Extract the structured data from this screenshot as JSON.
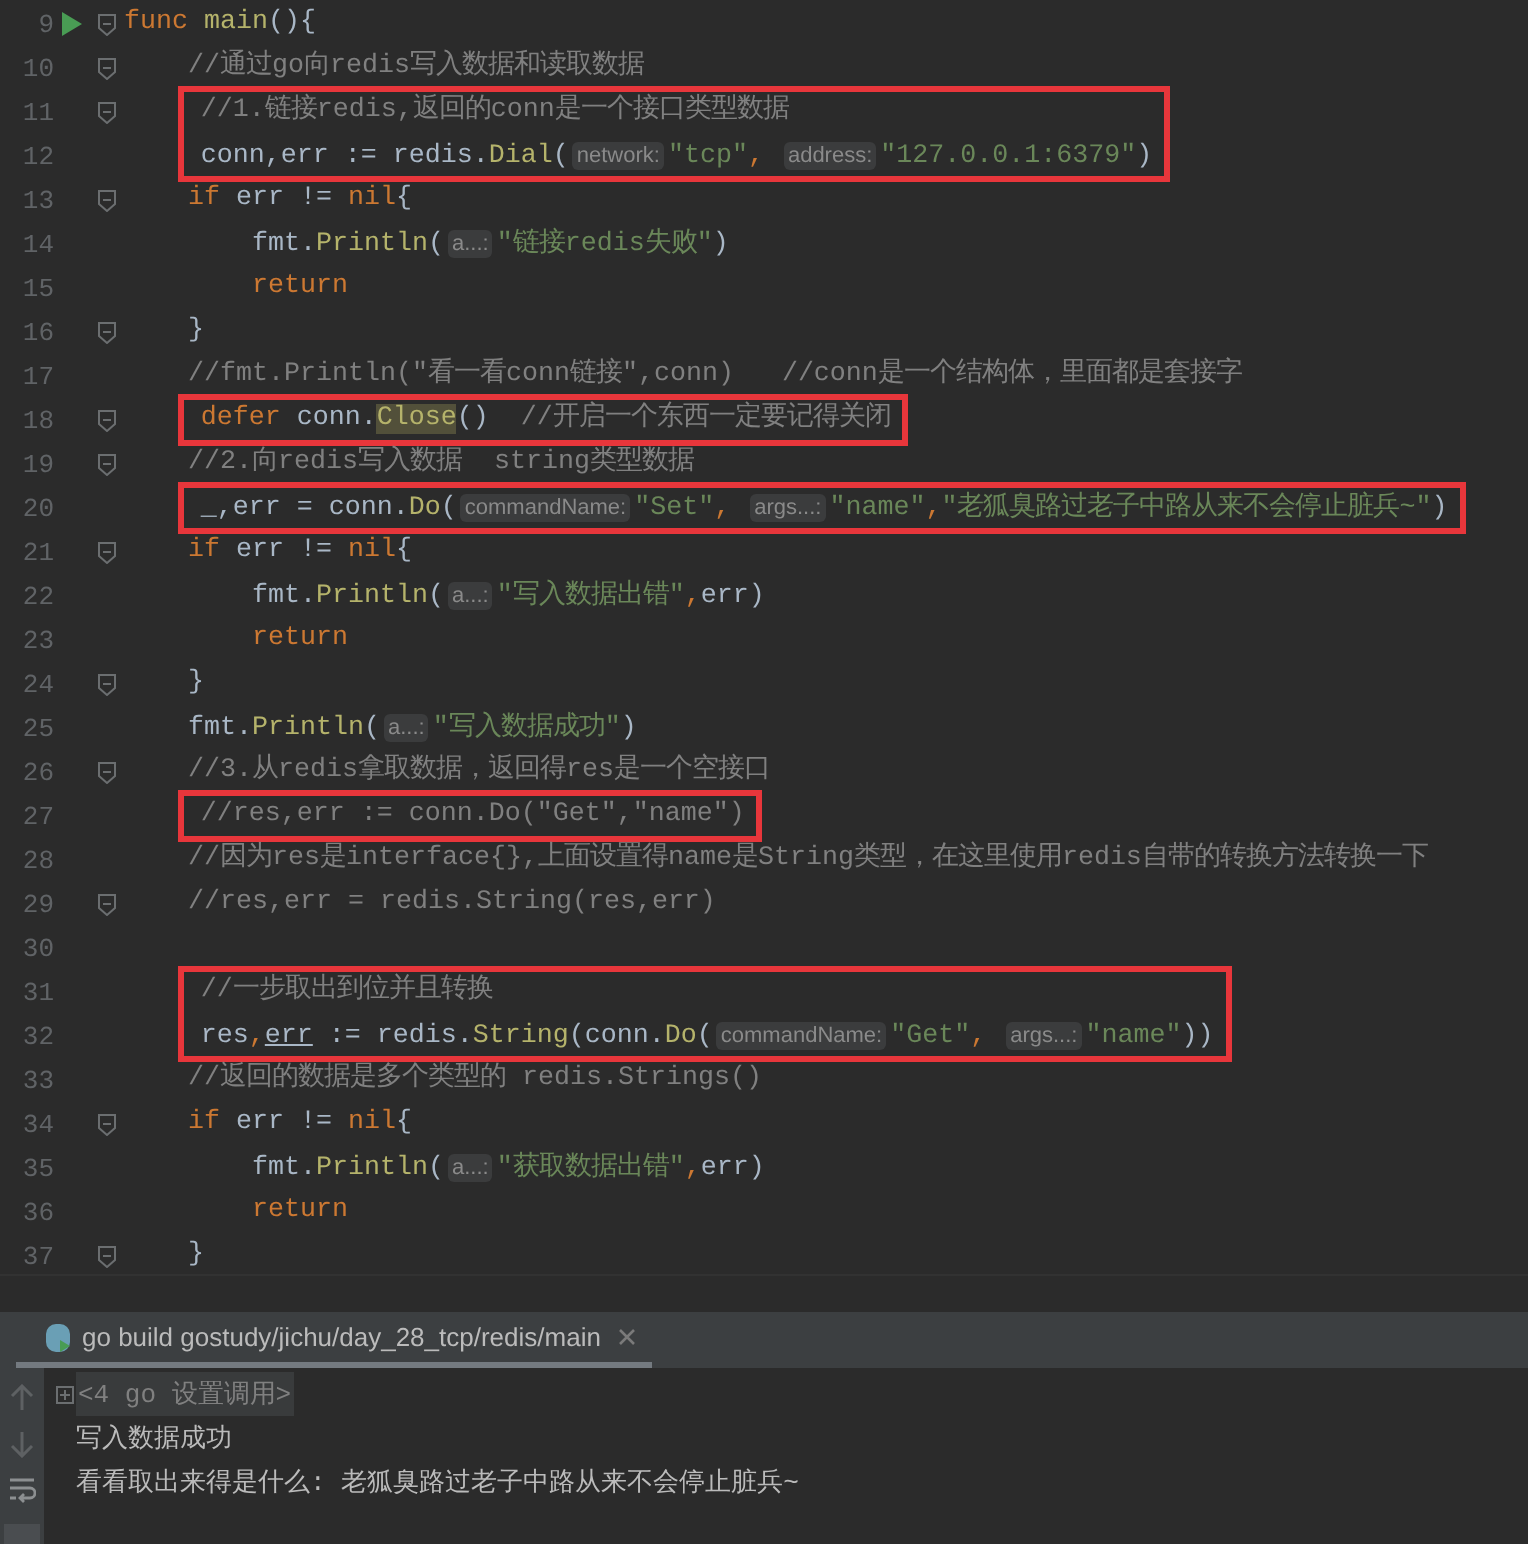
{
  "editor": {
    "lines": [
      {
        "number": "9",
        "run": true,
        "fold": true,
        "boxed": false,
        "tokens": [
          {
            "kind": "keyword",
            "text": "func "
          },
          {
            "kind": "function",
            "text": "main"
          },
          {
            "kind": "plain",
            "text": "(){"
          }
        ]
      },
      {
        "number": "10",
        "run": false,
        "fold": true,
        "boxed": false,
        "tokens": [
          {
            "kind": "comment",
            "text": "    //通过go向redis写入数据和读取数据"
          }
        ]
      },
      {
        "number": "11",
        "run": false,
        "fold": true,
        "boxed": true,
        "tokens": [
          {
            "kind": "comment",
            "text": "    //1.链接redis,返回的conn是一个接口类型数据"
          }
        ]
      },
      {
        "number": "12",
        "run": false,
        "fold": false,
        "boxed": true,
        "tokens": [
          {
            "kind": "plain",
            "text": "    conn,err := redis."
          },
          {
            "kind": "function",
            "text": "Dial"
          },
          {
            "kind": "plain",
            "text": "("
          },
          {
            "kind": "hint",
            "text": "network:"
          },
          {
            "kind": "string",
            "text": "\"tcp\""
          },
          {
            "kind": "keyword",
            "text": ", "
          },
          {
            "kind": "hint",
            "text": "address:"
          },
          {
            "kind": "string",
            "text": "\"127.0.0.1:6379\""
          },
          {
            "kind": "plain",
            "text": ")"
          }
        ]
      },
      {
        "number": "13",
        "run": false,
        "fold": true,
        "boxed": false,
        "tokens": [
          {
            "kind": "keyword",
            "text": "    if "
          },
          {
            "kind": "plain",
            "text": "err != "
          },
          {
            "kind": "keyword",
            "text": "nil"
          },
          {
            "kind": "plain",
            "text": "{"
          }
        ]
      },
      {
        "number": "14",
        "run": false,
        "fold": false,
        "boxed": false,
        "tokens": [
          {
            "kind": "plain",
            "text": "        fmt."
          },
          {
            "kind": "function",
            "text": "Println"
          },
          {
            "kind": "plain",
            "text": "("
          },
          {
            "kind": "hint",
            "text": "a...:"
          },
          {
            "kind": "string",
            "text": "\"链接redis失败\""
          },
          {
            "kind": "plain",
            "text": ")"
          }
        ]
      },
      {
        "number": "15",
        "run": false,
        "fold": false,
        "boxed": false,
        "tokens": [
          {
            "kind": "keyword",
            "text": "        return"
          }
        ]
      },
      {
        "number": "16",
        "run": false,
        "fold": true,
        "boxed": false,
        "tokens": [
          {
            "kind": "plain",
            "text": "    }"
          }
        ]
      },
      {
        "number": "17",
        "run": false,
        "fold": false,
        "boxed": false,
        "tokens": [
          {
            "kind": "comment",
            "text": "    //fmt.Println(\"看一看conn链接\",conn)   //conn是一个结构体，里面都是套接字"
          }
        ]
      },
      {
        "number": "18",
        "run": false,
        "fold": true,
        "boxed": true,
        "tokens": [
          {
            "kind": "keyword",
            "text": "    defer "
          },
          {
            "kind": "plain",
            "text": "conn."
          },
          {
            "kind": "function-highlighted",
            "text": "Close"
          },
          {
            "kind": "plain",
            "text": "()  "
          },
          {
            "kind": "comment",
            "text": "//开启一个东西一定要记得关闭"
          }
        ]
      },
      {
        "number": "19",
        "run": false,
        "fold": true,
        "boxed": false,
        "tokens": [
          {
            "kind": "comment",
            "text": "    //2.向redis写入数据  string类型数据"
          }
        ]
      },
      {
        "number": "20",
        "run": false,
        "fold": false,
        "boxed": true,
        "tokens": [
          {
            "kind": "plain",
            "text": "    _,err = conn."
          },
          {
            "kind": "function",
            "text": "Do"
          },
          {
            "kind": "plain",
            "text": "("
          },
          {
            "kind": "hint",
            "text": "commandName:"
          },
          {
            "kind": "string",
            "text": "\"Set\""
          },
          {
            "kind": "keyword",
            "text": ", "
          },
          {
            "kind": "hint",
            "text": "args...:"
          },
          {
            "kind": "string",
            "text": "\"name\""
          },
          {
            "kind": "keyword",
            "text": ","
          },
          {
            "kind": "string",
            "text": "\"老狐臭路过老子中路从来不会停止脏兵~\""
          },
          {
            "kind": "plain",
            "text": ")"
          }
        ]
      },
      {
        "number": "21",
        "run": false,
        "fold": true,
        "boxed": false,
        "tokens": [
          {
            "kind": "keyword",
            "text": "    if "
          },
          {
            "kind": "plain",
            "text": "err != "
          },
          {
            "kind": "keyword",
            "text": "nil"
          },
          {
            "kind": "plain",
            "text": "{"
          }
        ]
      },
      {
        "number": "22",
        "run": false,
        "fold": false,
        "boxed": false,
        "tokens": [
          {
            "kind": "plain",
            "text": "        fmt."
          },
          {
            "kind": "function",
            "text": "Println"
          },
          {
            "kind": "plain",
            "text": "("
          },
          {
            "kind": "hint",
            "text": "a...:"
          },
          {
            "kind": "string",
            "text": "\"写入数据出错\""
          },
          {
            "kind": "keyword",
            "text": ","
          },
          {
            "kind": "plain",
            "text": "err)"
          }
        ]
      },
      {
        "number": "23",
        "run": false,
        "fold": false,
        "boxed": false,
        "tokens": [
          {
            "kind": "keyword",
            "text": "        return"
          }
        ]
      },
      {
        "number": "24",
        "run": false,
        "fold": true,
        "boxed": false,
        "tokens": [
          {
            "kind": "plain",
            "text": "    }"
          }
        ]
      },
      {
        "number": "25",
        "run": false,
        "fold": false,
        "boxed": false,
        "tokens": [
          {
            "kind": "plain",
            "text": "    fmt."
          },
          {
            "kind": "function",
            "text": "Println"
          },
          {
            "kind": "plain",
            "text": "("
          },
          {
            "kind": "hint",
            "text": "a...:"
          },
          {
            "kind": "string",
            "text": "\"写入数据成功\""
          },
          {
            "kind": "plain",
            "text": ")"
          }
        ]
      },
      {
        "number": "26",
        "run": false,
        "fold": true,
        "boxed": false,
        "tokens": [
          {
            "kind": "comment",
            "text": "    //3.从redis拿取数据，返回得res是一个空接口"
          }
        ]
      },
      {
        "number": "27",
        "run": false,
        "fold": false,
        "boxed": true,
        "tokens": [
          {
            "kind": "comment",
            "text": "    //res,err := conn.Do(\"Get\",\"name\")"
          }
        ]
      },
      {
        "number": "28",
        "run": false,
        "fold": false,
        "boxed": false,
        "tokens": [
          {
            "kind": "comment",
            "text": "    //因为res是interface{},上面设置得name是String类型，在这里使用redis自带的转换方法转换一下"
          }
        ]
      },
      {
        "number": "29",
        "run": false,
        "fold": true,
        "boxed": false,
        "tokens": [
          {
            "kind": "comment",
            "text": "    //res,err = redis.String(res,err)"
          }
        ]
      },
      {
        "number": "30",
        "run": false,
        "fold": false,
        "boxed": false
      },
      {
        "number": "31",
        "run": false,
        "fold": false,
        "boxed": true,
        "tokens": [
          {
            "kind": "comment",
            "text": "    //一步取出到位并且转换"
          }
        ]
      },
      {
        "number": "32",
        "run": false,
        "fold": false,
        "boxed": true,
        "tokens": [
          {
            "kind": "plain",
            "text": "    res"
          },
          {
            "kind": "keyword",
            "text": ","
          },
          {
            "kind": "underlined",
            "text": "err"
          },
          {
            "kind": "plain",
            "text": " := redis."
          },
          {
            "kind": "function",
            "text": "String"
          },
          {
            "kind": "plain",
            "text": "(conn."
          },
          {
            "kind": "function",
            "text": "Do"
          },
          {
            "kind": "plain",
            "text": "("
          },
          {
            "kind": "hint",
            "text": "commandName:"
          },
          {
            "kind": "string",
            "text": "\"Get\""
          },
          {
            "kind": "keyword",
            "text": ", "
          },
          {
            "kind": "hint",
            "text": "args...:"
          },
          {
            "kind": "string",
            "text": "\"name\""
          },
          {
            "kind": "plain",
            "text": "))"
          }
        ]
      },
      {
        "number": "33",
        "run": false,
        "fold": false,
        "boxed": false,
        "tokens": [
          {
            "kind": "comment",
            "text": "    //返回的数据是多个类型的 redis.Strings()"
          }
        ]
      },
      {
        "number": "34",
        "run": false,
        "fold": true,
        "boxed": false,
        "tokens": [
          {
            "kind": "keyword",
            "text": "    if "
          },
          {
            "kind": "plain",
            "text": "err != "
          },
          {
            "kind": "keyword",
            "text": "nil"
          },
          {
            "kind": "plain",
            "text": "{"
          }
        ]
      },
      {
        "number": "35",
        "run": false,
        "fold": false,
        "boxed": false,
        "tokens": [
          {
            "kind": "plain",
            "text": "        fmt."
          },
          {
            "kind": "function",
            "text": "Println"
          },
          {
            "kind": "plain",
            "text": "("
          },
          {
            "kind": "hint",
            "text": "a...:"
          },
          {
            "kind": "string",
            "text": "\"获取数据出错\""
          },
          {
            "kind": "keyword",
            "text": ","
          },
          {
            "kind": "plain",
            "text": "err)"
          }
        ]
      },
      {
        "number": "36",
        "run": false,
        "fold": false,
        "boxed": false,
        "tokens": [
          {
            "kind": "keyword",
            "text": "        return"
          }
        ]
      },
      {
        "number": "37",
        "run": false,
        "fold": true,
        "boxed": false,
        "tokens": [
          {
            "kind": "plain",
            "text": "    }"
          }
        ]
      }
    ]
  },
  "run_panel": {
    "tab": {
      "label": "go build gostudy/jichu/day_28_tcp/redis/main",
      "selected": true
    },
    "console": [
      {
        "kind": "folded",
        "text": "<4 go 设置调用>"
      },
      {
        "kind": "output",
        "text": "写入数据成功"
      },
      {
        "kind": "output",
        "text": "看看取出来得是什么: 老狐臭路过老子中路从来不会停止脏兵~"
      }
    ]
  }
}
